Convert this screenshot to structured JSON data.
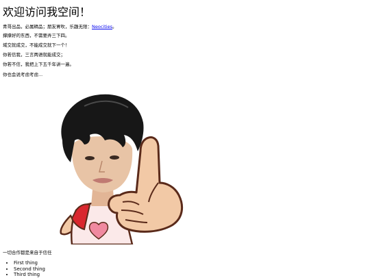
{
  "page": {
    "title": "欢迎访问我空间！",
    "intro_prefix": "青哥出品，必属精品；朋友胃吹，乐趣无限：",
    "intro_link": "Neocities",
    "intro_suffix": "。",
    "lines": [
      "撑撑好的东西，不需要弄三下四。",
      "域交就成交，不能成交就下一个！",
      "你若信我，三言两语就能成交；",
      "你若不信，我把上下五千年讲一遍。",
      "你也会说考虑考虑..."
    ],
    "closing": "一切合作都是来自于信任",
    "list": [
      "First thing",
      "Second thing",
      "Third thing"
    ]
  },
  "sticker": {
    "description_icon": "pointing-boy-sticker",
    "colors": {
      "hair": "#171717",
      "skin": "#e8c4a6",
      "hand": "#f2c9a6",
      "outline": "#5a2a1a",
      "shirt": "#fbe9e9",
      "sleeve": "#d9272e",
      "heart": "#f08aa0"
    }
  }
}
